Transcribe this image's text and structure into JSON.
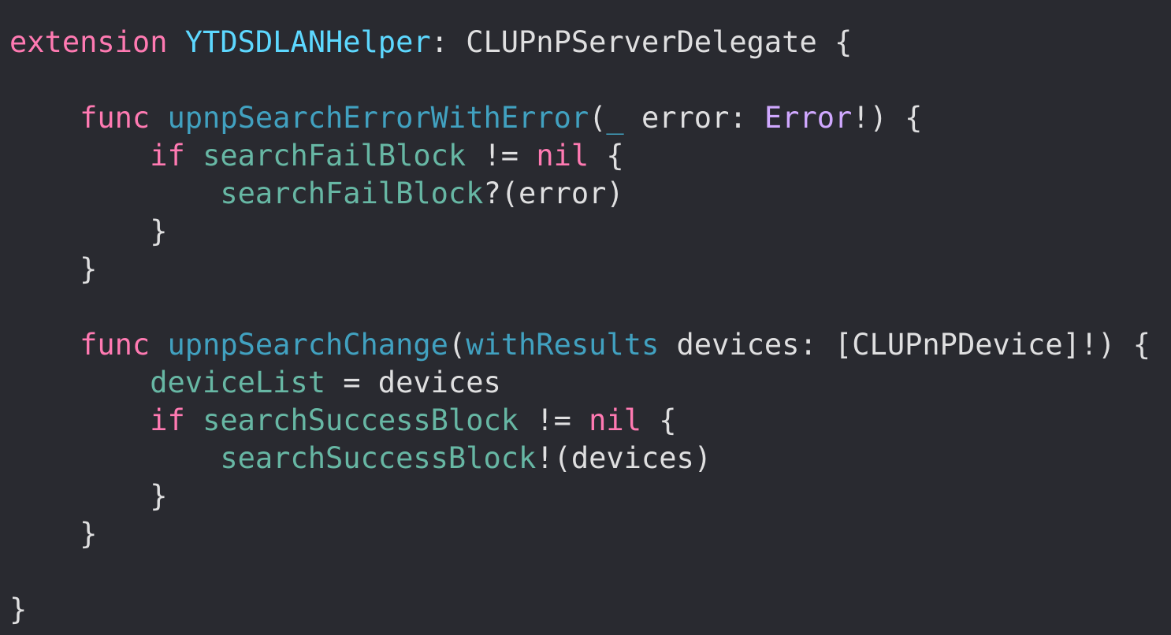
{
  "editor": {
    "theme": {
      "background": "#292a30",
      "keyword": "#ff7ab2",
      "type_declaration": "#5dd8ff",
      "function_declaration": "#41a1c0",
      "project_identifier": "#67b7a4",
      "system_type": "#d0a8ff",
      "plain_text": "#dfdfe0"
    },
    "lines": [
      [
        {
          "t": "extension",
          "c": "kw"
        },
        {
          "t": " ",
          "c": "plain"
        },
        {
          "t": "YTDSDLANHelper",
          "c": "type-decl"
        },
        {
          "t": ": ",
          "c": "plain"
        },
        {
          "t": "CLUPnPServerDelegate",
          "c": "type-proj"
        },
        {
          "t": " {",
          "c": "plain"
        }
      ],
      [],
      [
        {
          "t": "    ",
          "c": "plain"
        },
        {
          "t": "func",
          "c": "kw"
        },
        {
          "t": " ",
          "c": "plain"
        },
        {
          "t": "upnpSearchErrorWithError",
          "c": "func-decl"
        },
        {
          "t": "(",
          "c": "plain"
        },
        {
          "t": "_",
          "c": "func-decl"
        },
        {
          "t": " error: ",
          "c": "plain"
        },
        {
          "t": "Error",
          "c": "type-sys"
        },
        {
          "t": "!) {",
          "c": "plain"
        }
      ],
      [
        {
          "t": "        ",
          "c": "plain"
        },
        {
          "t": "if",
          "c": "kw"
        },
        {
          "t": " ",
          "c": "plain"
        },
        {
          "t": "searchFailBlock",
          "c": "ident"
        },
        {
          "t": " != ",
          "c": "plain"
        },
        {
          "t": "nil",
          "c": "kw"
        },
        {
          "t": " {",
          "c": "plain"
        }
      ],
      [
        {
          "t": "            ",
          "c": "plain"
        },
        {
          "t": "searchFailBlock",
          "c": "ident"
        },
        {
          "t": "?(error)",
          "c": "plain"
        }
      ],
      [
        {
          "t": "        }",
          "c": "plain"
        }
      ],
      [
        {
          "t": "    }",
          "c": "plain"
        }
      ],
      [],
      [
        {
          "t": "    ",
          "c": "plain"
        },
        {
          "t": "func",
          "c": "kw"
        },
        {
          "t": " ",
          "c": "plain"
        },
        {
          "t": "upnpSearchChange",
          "c": "func-decl"
        },
        {
          "t": "(",
          "c": "plain"
        },
        {
          "t": "withResults",
          "c": "func-decl"
        },
        {
          "t": " devices: [CLUPnPDevice]!) {",
          "c": "plain"
        }
      ],
      [
        {
          "t": "        ",
          "c": "plain"
        },
        {
          "t": "deviceList",
          "c": "ident"
        },
        {
          "t": " = devices",
          "c": "plain"
        }
      ],
      [
        {
          "t": "        ",
          "c": "plain"
        },
        {
          "t": "if",
          "c": "kw"
        },
        {
          "t": " ",
          "c": "plain"
        },
        {
          "t": "searchSuccessBlock",
          "c": "ident"
        },
        {
          "t": " != ",
          "c": "plain"
        },
        {
          "t": "nil",
          "c": "kw"
        },
        {
          "t": " {",
          "c": "plain"
        }
      ],
      [
        {
          "t": "            ",
          "c": "plain"
        },
        {
          "t": "searchSuccessBlock",
          "c": "ident"
        },
        {
          "t": "!(devices)",
          "c": "plain"
        }
      ],
      [
        {
          "t": "        }",
          "c": "plain"
        }
      ],
      [
        {
          "t": "    }",
          "c": "plain"
        }
      ],
      [],
      [
        {
          "t": "}",
          "c": "plain"
        }
      ]
    ]
  }
}
